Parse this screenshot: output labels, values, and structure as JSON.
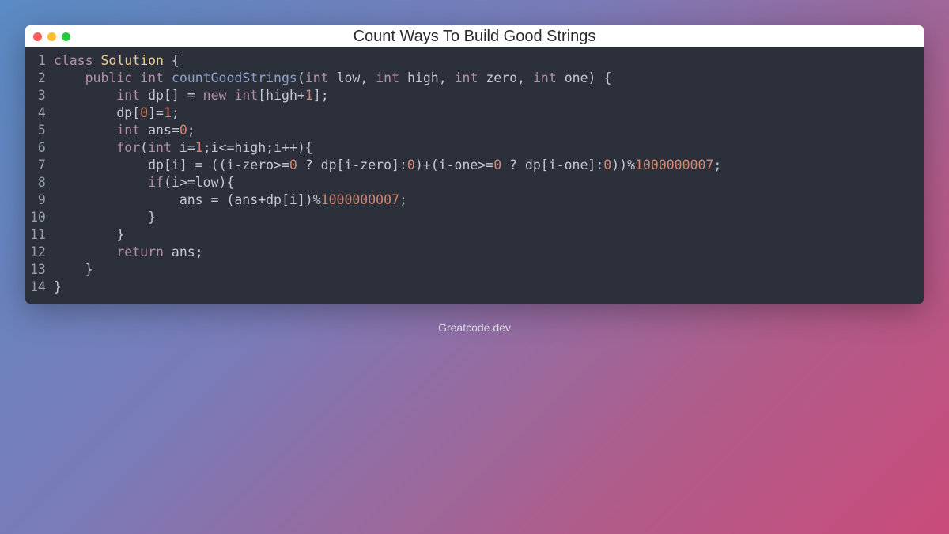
{
  "window": {
    "title": "Count Ways To Build Good Strings"
  },
  "watermark": "Greatcode.dev",
  "code": {
    "line_count": 14,
    "lines": [
      [
        {
          "t": "class ",
          "c": "kw"
        },
        {
          "t": "Solution",
          "c": "cls"
        },
        {
          "t": " {",
          "c": "op"
        }
      ],
      [
        {
          "t": "    ",
          "c": ""
        },
        {
          "t": "public ",
          "c": "kw"
        },
        {
          "t": "int ",
          "c": "type"
        },
        {
          "t": "countGoodStrings",
          "c": "fn"
        },
        {
          "t": "(",
          "c": "op"
        },
        {
          "t": "int ",
          "c": "type"
        },
        {
          "t": "low, ",
          "c": "op"
        },
        {
          "t": "int ",
          "c": "type"
        },
        {
          "t": "high, ",
          "c": "op"
        },
        {
          "t": "int ",
          "c": "type"
        },
        {
          "t": "zero, ",
          "c": "op"
        },
        {
          "t": "int ",
          "c": "type"
        },
        {
          "t": "one) {",
          "c": "op"
        }
      ],
      [
        {
          "t": "        ",
          "c": ""
        },
        {
          "t": "int ",
          "c": "type"
        },
        {
          "t": "dp[] = ",
          "c": "op"
        },
        {
          "t": "new ",
          "c": "kw"
        },
        {
          "t": "int",
          "c": "type"
        },
        {
          "t": "[high+",
          "c": "op"
        },
        {
          "t": "1",
          "c": "num"
        },
        {
          "t": "];",
          "c": "op"
        }
      ],
      [
        {
          "t": "        dp[",
          "c": "op"
        },
        {
          "t": "0",
          "c": "num"
        },
        {
          "t": "]=",
          "c": "op"
        },
        {
          "t": "1",
          "c": "num"
        },
        {
          "t": ";",
          "c": "op"
        }
      ],
      [
        {
          "t": "        ",
          "c": ""
        },
        {
          "t": "int ",
          "c": "type"
        },
        {
          "t": "ans=",
          "c": "op"
        },
        {
          "t": "0",
          "c": "num"
        },
        {
          "t": ";",
          "c": "op"
        }
      ],
      [
        {
          "t": "        ",
          "c": ""
        },
        {
          "t": "for",
          "c": "kw"
        },
        {
          "t": "(",
          "c": "op"
        },
        {
          "t": "int ",
          "c": "type"
        },
        {
          "t": "i=",
          "c": "op"
        },
        {
          "t": "1",
          "c": "num"
        },
        {
          "t": ";i<=high;i++){",
          "c": "op"
        }
      ],
      [
        {
          "t": "            dp[i] = ((i-zero>=",
          "c": "op"
        },
        {
          "t": "0",
          "c": "num"
        },
        {
          "t": " ? dp[i-zero]:",
          "c": "op"
        },
        {
          "t": "0",
          "c": "num"
        },
        {
          "t": ")+(i-one>=",
          "c": "op"
        },
        {
          "t": "0",
          "c": "num"
        },
        {
          "t": " ? dp[i-one]:",
          "c": "op"
        },
        {
          "t": "0",
          "c": "num"
        },
        {
          "t": "))%",
          "c": "op"
        },
        {
          "t": "1000000007",
          "c": "num"
        },
        {
          "t": ";",
          "c": "op"
        }
      ],
      [
        {
          "t": "            ",
          "c": ""
        },
        {
          "t": "if",
          "c": "kw"
        },
        {
          "t": "(i>=low){",
          "c": "op"
        }
      ],
      [
        {
          "t": "                ans = (ans+dp[i])%",
          "c": "op"
        },
        {
          "t": "1000000007",
          "c": "num"
        },
        {
          "t": ";",
          "c": "op"
        }
      ],
      [
        {
          "t": "            }",
          "c": "op"
        }
      ],
      [
        {
          "t": "        }",
          "c": "op"
        }
      ],
      [
        {
          "t": "        ",
          "c": ""
        },
        {
          "t": "return ",
          "c": "kw"
        },
        {
          "t": "ans;",
          "c": "op"
        }
      ],
      [
        {
          "t": "    }",
          "c": "op"
        }
      ],
      [
        {
          "t": "}",
          "c": "op"
        }
      ]
    ]
  }
}
